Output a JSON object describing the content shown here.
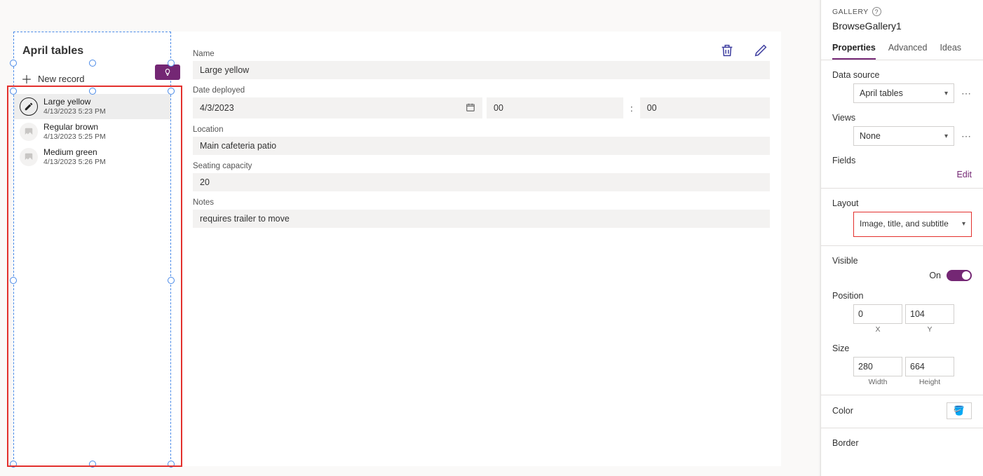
{
  "left": {
    "title": "April tables",
    "new_label": "New record",
    "records": [
      {
        "title": "Large yellow",
        "sub": "4/13/2023 5:23 PM"
      },
      {
        "title": "Regular brown",
        "sub": "4/13/2023 5:25 PM"
      },
      {
        "title": "Medium green",
        "sub": "4/13/2023 5:26 PM"
      }
    ]
  },
  "detail": {
    "labels": {
      "name": "Name",
      "date_deployed": "Date deployed",
      "location": "Location",
      "seating": "Seating capacity",
      "notes": "Notes"
    },
    "name": "Large yellow",
    "date": "4/3/2023",
    "hour": "00",
    "minute": "00",
    "location": "Main cafeteria patio",
    "seating": "20",
    "notes": "requires trailer to move"
  },
  "props": {
    "header": "GALLERY",
    "name": "BrowseGallery1",
    "tabs": {
      "properties": "Properties",
      "advanced": "Advanced",
      "ideas": "Ideas"
    },
    "data_source_label": "Data source",
    "data_source_value": "April tables",
    "views_label": "Views",
    "views_value": "None",
    "fields_label": "Fields",
    "fields_edit": "Edit",
    "layout_label": "Layout",
    "layout_value": "Image, title, and subtitle",
    "visible_label": "Visible",
    "visible_on": "On",
    "position_label": "Position",
    "position": {
      "x": "0",
      "y": "104",
      "xl": "X",
      "yl": "Y"
    },
    "size_label": "Size",
    "size": {
      "w": "280",
      "h": "664",
      "wl": "Width",
      "hl": "Height"
    },
    "color_label": "Color",
    "border_label": "Border"
  }
}
